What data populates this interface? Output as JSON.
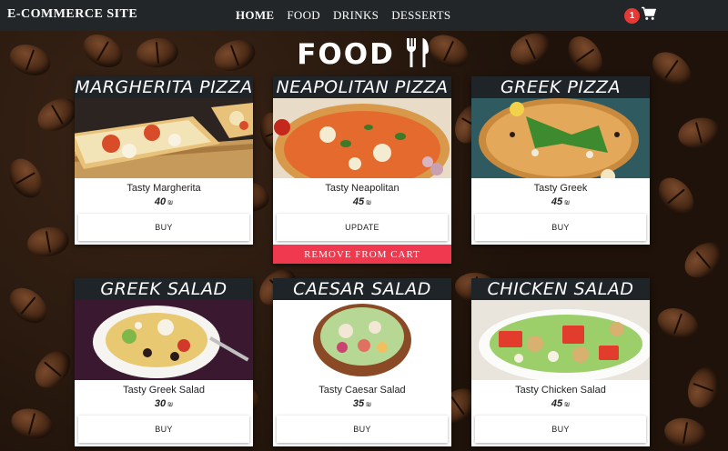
{
  "navbar": {
    "brand": "E-COMMERCE SITE",
    "links": [
      "HOME",
      "FOOD",
      "DRINKS",
      "DESSERTS"
    ],
    "cart_count": "1"
  },
  "page_heading": "FOOD",
  "cards": [
    {
      "title": "MARGHERITA PIZZA",
      "description": "Tasty Margherita",
      "price": "40",
      "currency": "₪",
      "button": "BUY"
    },
    {
      "title": "NEAPOLITAN PIZZA",
      "description": "Tasty Neapolitan",
      "price": "45",
      "currency": "₪",
      "button": "UPDATE",
      "remove": "REMOVE FROM CART"
    },
    {
      "title": "GREEK PIZZA",
      "description": "Tasty Greek",
      "price": "45",
      "currency": "₪",
      "button": "BUY"
    },
    {
      "title": "GREEK SALAD",
      "description": "Tasty Greek Salad",
      "price": "30",
      "currency": "₪",
      "button": "BUY"
    },
    {
      "title": "CAESAR SALAD",
      "description": "Tasty Caesar Salad",
      "price": "35",
      "currency": "₪",
      "button": "BUY"
    },
    {
      "title": "CHICKEN SALAD",
      "description": "Tasty Chicken Salad",
      "price": "45",
      "currency": "₪",
      "button": "BUY"
    }
  ],
  "colors": {
    "navbar": "#222629",
    "remove_button": "#f0394f",
    "badge": "#e53935"
  }
}
